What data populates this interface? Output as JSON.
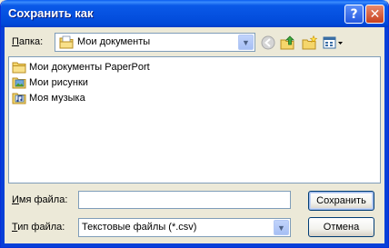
{
  "window": {
    "title": "Сохранить как",
    "help_label": "?",
    "close_label": "✕"
  },
  "toolbar": {
    "folder_label": "Папка:",
    "folder_label_accel": "П",
    "folder_label_rest": "апка:",
    "folder_value": "Мои документы"
  },
  "files": [
    {
      "name": "Мои документы PaperPort",
      "icon": "folder-icon"
    },
    {
      "name": "Мои рисунки",
      "icon": "pictures-folder-icon"
    },
    {
      "name": "Моя музыка",
      "icon": "music-folder-icon"
    }
  ],
  "form": {
    "filename_label_accel": "И",
    "filename_label_rest": "мя файла:",
    "filename_value": "",
    "filetype_label_accel": "Т",
    "filetype_label_rest": "ип файла:",
    "filetype_value": "Текстовые файлы (*.csv)"
  },
  "buttons": {
    "save": "Сохранить",
    "cancel": "Отмена"
  }
}
